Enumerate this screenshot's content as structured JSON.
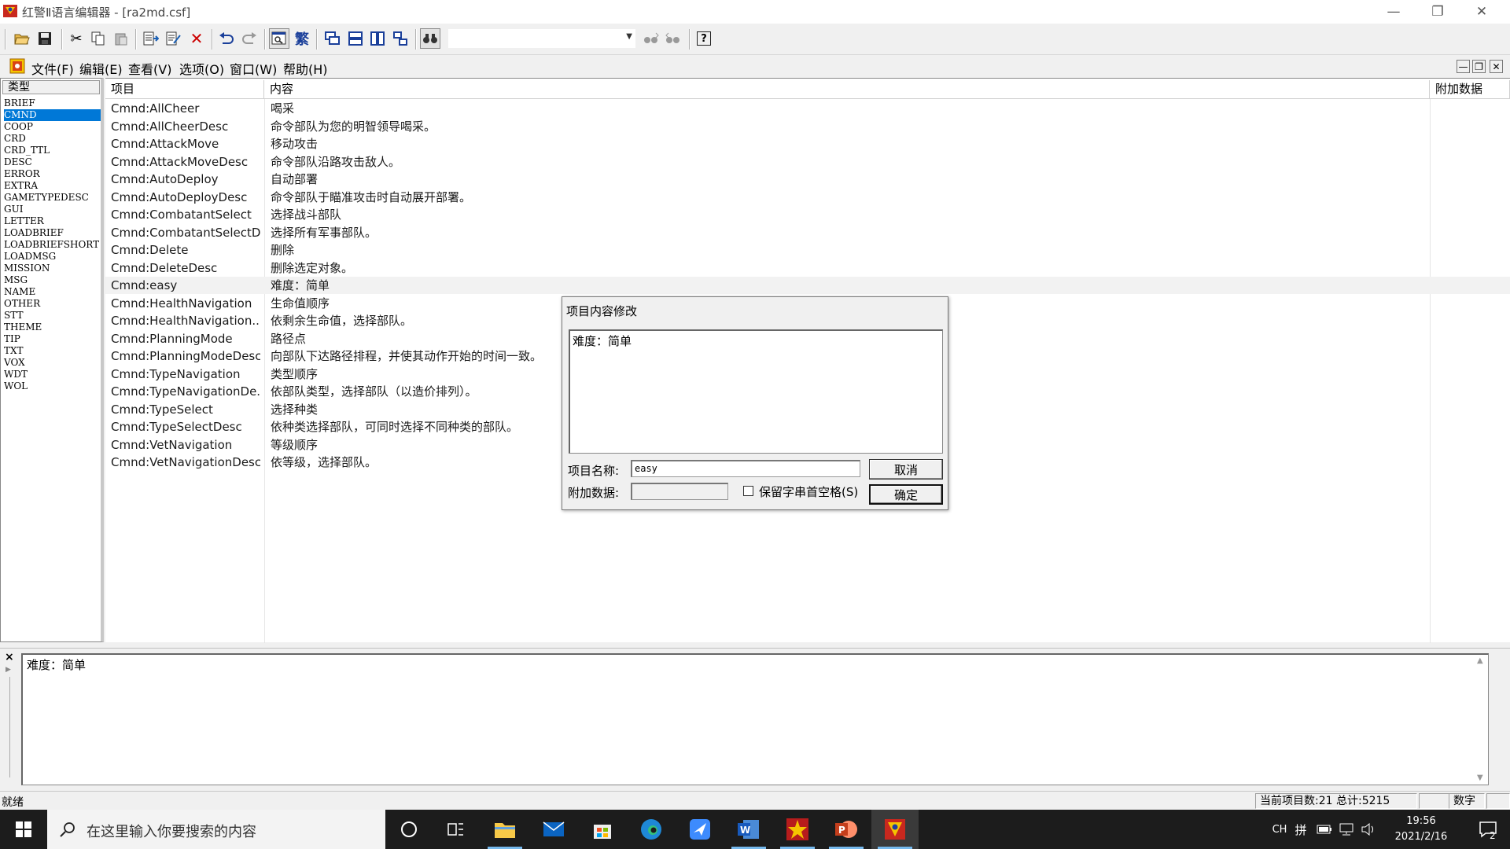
{
  "window": {
    "title": "红警Ⅱ语言编辑器 - [ra2md.csf]",
    "minimize_icon": "minimize-icon",
    "maximize_icon": "restore-icon",
    "close_icon": "close-icon"
  },
  "toolbar": {
    "buttons": [
      "open",
      "save",
      "cut",
      "copy",
      "paste",
      "insert",
      "edit",
      "delete",
      "undo",
      "redo",
      "find",
      "traditional",
      "tile-horizontal",
      "tile-vertical",
      "columns",
      "tree",
      "filter",
      "find-next",
      "find-prev",
      "help"
    ],
    "traditional_label": "繁",
    "help_label": "?",
    "combo_value": ""
  },
  "menubar": {
    "items": [
      "文件(F)",
      "编辑(E)",
      "查看(V)",
      "选项(O)",
      "窗口(W)",
      "帮助(H)"
    ]
  },
  "typelist": {
    "header": "类型",
    "items": [
      "BRIEF",
      "CMND",
      "COOP",
      "CRD",
      "CRD_TTL",
      "DESC",
      "ERROR",
      "EXTRA",
      "GAMETYPEDESC",
      "GUI",
      "LETTER",
      "LOADBRIEF",
      "LOADBRIEFSHORT",
      "LOADMSG",
      "MISSION",
      "MSG",
      "NAME",
      "OTHER",
      "STT",
      "THEME",
      "TIP",
      "TXT",
      "VOX",
      "WDT",
      "WOL"
    ],
    "selected_index": 1
  },
  "mainlist": {
    "columns": [
      "项目",
      "内容",
      "附加数据"
    ],
    "rows": [
      {
        "item": "Cmnd:AllCheer",
        "content": "喝采"
      },
      {
        "item": "Cmnd:AllCheerDesc",
        "content": "命令部队为您的明智领导喝采。"
      },
      {
        "item": "Cmnd:AttackMove",
        "content": "移动攻击"
      },
      {
        "item": "Cmnd:AttackMoveDesc",
        "content": "命令部队沿路攻击敌人。"
      },
      {
        "item": "Cmnd:AutoDeploy",
        "content": "自动部署"
      },
      {
        "item": "Cmnd:AutoDeployDesc",
        "content": "命令部队于瞄准攻击时自动展开部署。"
      },
      {
        "item": "Cmnd:CombatantSelect",
        "content": "选择战斗部队"
      },
      {
        "item": "Cmnd:CombatantSelectD...",
        "content": "选择所有军事部队。"
      },
      {
        "item": "Cmnd:Delete",
        "content": "删除"
      },
      {
        "item": "Cmnd:DeleteDesc",
        "content": "删除选定对象。"
      },
      {
        "item": "Cmnd:easy",
        "content": "难度：简单"
      },
      {
        "item": "Cmnd:HealthNavigation",
        "content": "生命值顺序"
      },
      {
        "item": "Cmnd:HealthNavigation...",
        "content": "依剩余生命值，选择部队。"
      },
      {
        "item": "Cmnd:PlanningMode",
        "content": "路径点"
      },
      {
        "item": "Cmnd:PlanningModeDesc",
        "content": "向部队下达路径排程，并使其动作开始的时间一致。"
      },
      {
        "item": "Cmnd:TypeNavigation",
        "content": "类型顺序"
      },
      {
        "item": "Cmnd:TypeNavigationDe...",
        "content": "依部队类型，选择部队（以造价排列）。"
      },
      {
        "item": "Cmnd:TypeSelect",
        "content": "选择种类"
      },
      {
        "item": "Cmnd:TypeSelectDesc",
        "content": "依种类选择部队，可同时选择不同种类的部队。"
      },
      {
        "item": "Cmnd:VetNavigation",
        "content": "等级顺序"
      },
      {
        "item": "Cmnd:VetNavigationDesc",
        "content": "依等级，选择部队。"
      }
    ],
    "highlighted_index": 10
  },
  "dialog": {
    "title": "项目内容修改",
    "content_text": "难度：简单",
    "name_label": "项目名称:",
    "name_value": "easy",
    "extra_label": "附加数据:",
    "extra_value": "",
    "checkbox_label": "保留字串首空格(S)",
    "checkbox_checked": false,
    "cancel_label": "取消",
    "ok_label": "确定"
  },
  "bottom_panel": {
    "close_glyph": "×",
    "text": "难度：简单"
  },
  "statusbar": {
    "ready": "就绪",
    "count": "当前项目数:21  总计:5215",
    "numlock": "数字"
  },
  "taskbar": {
    "search_placeholder": "在这里输入你要搜索的内容",
    "apps": [
      "cortana",
      "task-view",
      "file-explorer",
      "mail",
      "store",
      "edge",
      "feishu",
      "word",
      "fa2",
      "powerpoint",
      "ra2-editor"
    ],
    "lang": "CH",
    "ime": "拼",
    "time": "19:56",
    "date": "2021/2/16",
    "notif_count": "2"
  }
}
